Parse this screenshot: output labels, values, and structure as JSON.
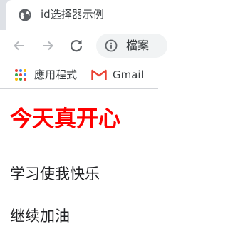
{
  "browser": {
    "tab_title": "id选择器示例",
    "omnibox_chip": "檔案",
    "bookmarks": [
      {
        "label": "應用程式",
        "icon": "apps-grid-icon"
      },
      {
        "label": "Gmail",
        "icon": "gmail-icon"
      }
    ],
    "icons": {
      "favicon": "globe-icon",
      "back": "back-arrow-icon",
      "forward": "forward-arrow-icon",
      "reload": "reload-icon",
      "info": "info-icon"
    }
  },
  "page": {
    "heading": "今天真开心",
    "paragraphs": [
      "学习使我快乐",
      "继续加油"
    ]
  },
  "colors": {
    "heading": "#ff0000",
    "tabstrip": "#dee1e6",
    "omnibox": "#f1f3f4",
    "gmail_red": "#ea4335"
  }
}
